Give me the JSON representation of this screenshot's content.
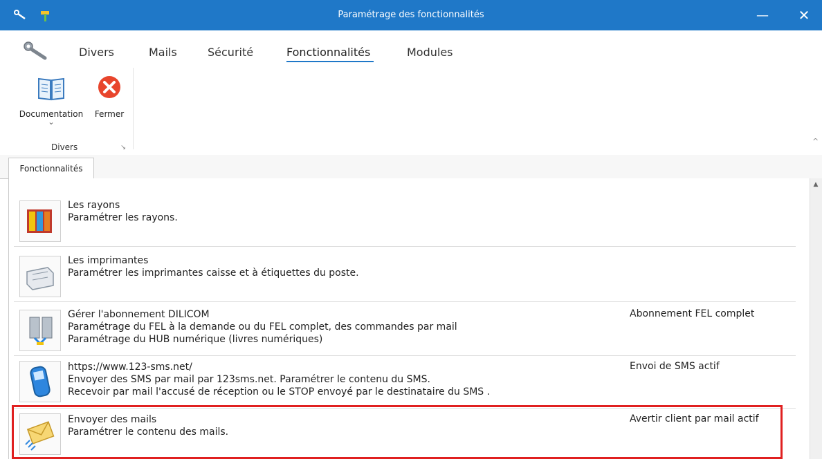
{
  "window": {
    "title": "Paramétrage des fonctionnalités",
    "minimize": "—",
    "close": "✕"
  },
  "menu": {
    "tabs": [
      "Divers",
      "Mails",
      "Sécurité",
      "Fonctionnalités",
      "Modules"
    ],
    "active": "Fonctionnalités"
  },
  "ribbon": {
    "documentation_label": "Documentation",
    "close_label": "Fermer",
    "group_label": "Divers",
    "chevron": "⌄",
    "launcher": "↘",
    "collapse": "^"
  },
  "tab": {
    "label": "Fonctionnalités"
  },
  "scroll_up": "▲",
  "items": [
    {
      "icon": "shelf-icon",
      "title": "Les rayons",
      "lines": [
        "Paramétrer les rayons."
      ],
      "status": ""
    },
    {
      "icon": "printer-icon",
      "title": "Les imprimantes",
      "lines": [
        "Paramétrer les imprimantes caisse et à étiquettes du poste."
      ],
      "status": ""
    },
    {
      "icon": "network-icon",
      "title": "Gérer l'abonnement DILICOM",
      "lines": [
        "Paramétrage du FEL à la demande ou du FEL complet, des commandes par mail",
        "Paramétrage du HUB numérique (livres numériques)"
      ],
      "status": "Abonnement FEL complet"
    },
    {
      "icon": "phone-icon",
      "title": "https://www.123-sms.net/",
      "lines": [
        "Envoyer des SMS par mail par 123sms.net. Paramétrer le contenu du SMS.",
        "Recevoir par mail l'accusé de réception ou le STOP envoyé par le destinataire du SMS ."
      ],
      "status": "Envoi de SMS actif"
    },
    {
      "icon": "mail-icon",
      "title": "Envoyer des mails",
      "lines": [
        "Paramétrer le contenu des mails."
      ],
      "status": "Avertir client par mail actif"
    }
  ]
}
